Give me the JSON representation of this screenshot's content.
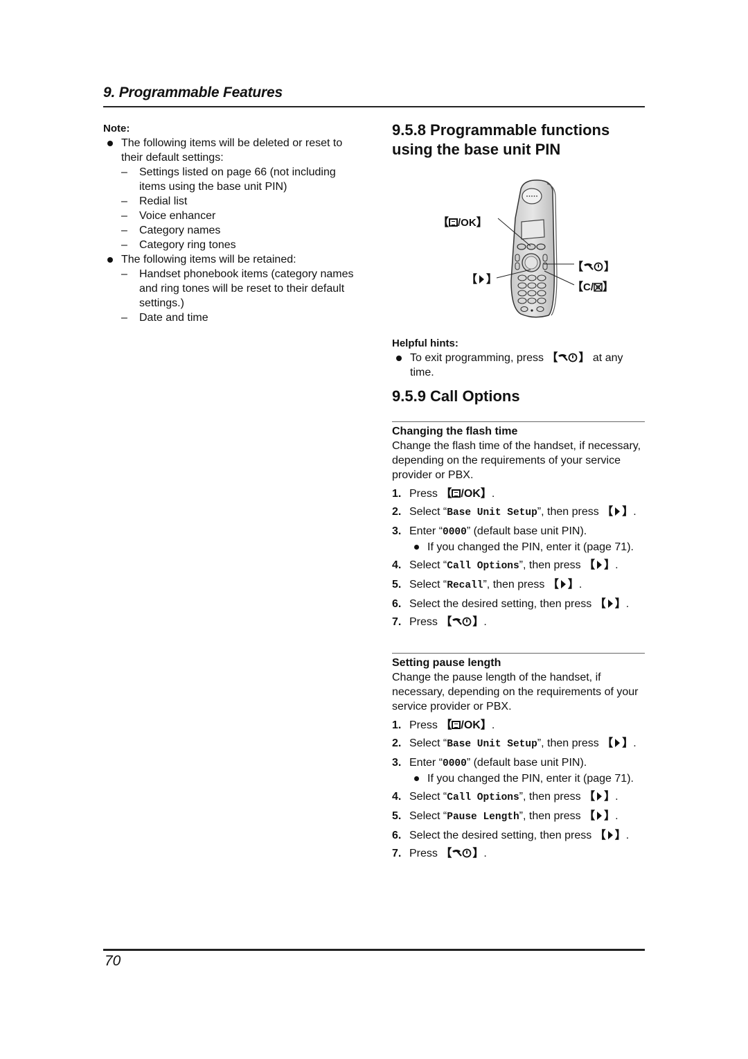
{
  "header": {
    "chapter_title": "9. Programmable Features"
  },
  "left": {
    "note_label": "Note:",
    "bullet1": "The following items will be deleted or reset to their default settings:",
    "deleted_items": [
      "Settings listed on page 66 (not including items using the base unit PIN)",
      "Redial list",
      "Voice enhancer",
      "Category names",
      "Category ring tones"
    ],
    "bullet2": "The following items will be retained:",
    "retained_items": [
      "Handset phonebook items (category names and ring tones will be reset to their default settings.)",
      "Date and time"
    ],
    "dash": "–"
  },
  "section_958": {
    "title": "9.5.8 Programmable functions using the base unit PIN",
    "callouts": {
      "menu_ok": "/OK",
      "right": "",
      "off": "",
      "clear": "C/"
    },
    "hints_label": "Helpful hints:",
    "hint_prefix": "To exit programming, press",
    "hint_suffix": "at any time."
  },
  "section_959": {
    "title": "9.5.9 Call Options",
    "flash": {
      "label": "Changing the flash time",
      "description": "Change the flash time of the handset, if necessary, depending on the requirements of your service provider or PBX.",
      "steps": [
        {
          "num": "1.",
          "text": "Press",
          "key": "menu-ok"
        },
        {
          "num": "2.",
          "pre": "Select “",
          "code": "Base Unit Setup",
          "post": "”, then press",
          "key": "right"
        },
        {
          "num": "3.",
          "pre": "Enter “",
          "code": "0000",
          "post": "” (default base unit PIN).",
          "sub": "If you changed the PIN, enter it (page 71)."
        },
        {
          "num": "4.",
          "pre": "Select “",
          "code": "Call Options",
          "post": "”, then press",
          "key": "right"
        },
        {
          "num": "5.",
          "pre": "Select “",
          "code": "Recall",
          "post": "”, then press",
          "key": "right"
        },
        {
          "num": "6.",
          "text": "Select the desired setting, then press",
          "key": "right"
        },
        {
          "num": "7.",
          "text": "Press",
          "key": "off"
        }
      ]
    },
    "pause": {
      "label": "Setting pause length",
      "description": "Change the pause length of the handset, if necessary, depending on the requirements of your service provider or PBX.",
      "steps": [
        {
          "num": "1.",
          "text": "Press",
          "key": "menu-ok"
        },
        {
          "num": "2.",
          "pre": "Select “",
          "code": "Base Unit Setup",
          "post": "”, then press",
          "key": "right"
        },
        {
          "num": "3.",
          "pre": "Enter “",
          "code": "0000",
          "post": "” (default base unit PIN).",
          "sub": "If you changed the PIN, enter it (page 71)."
        },
        {
          "num": "4.",
          "pre": "Select “",
          "code": "Call Options",
          "post": "”, then press",
          "key": "right"
        },
        {
          "num": "5.",
          "pre": "Select “",
          "code": "Pause Length",
          "post": "”, then press",
          "key": "right"
        },
        {
          "num": "6.",
          "text": "Select the desired setting, then press",
          "key": "right"
        },
        {
          "num": "7.",
          "text": "Press",
          "key": "off"
        }
      ]
    }
  },
  "footer": {
    "page_number": "70"
  }
}
